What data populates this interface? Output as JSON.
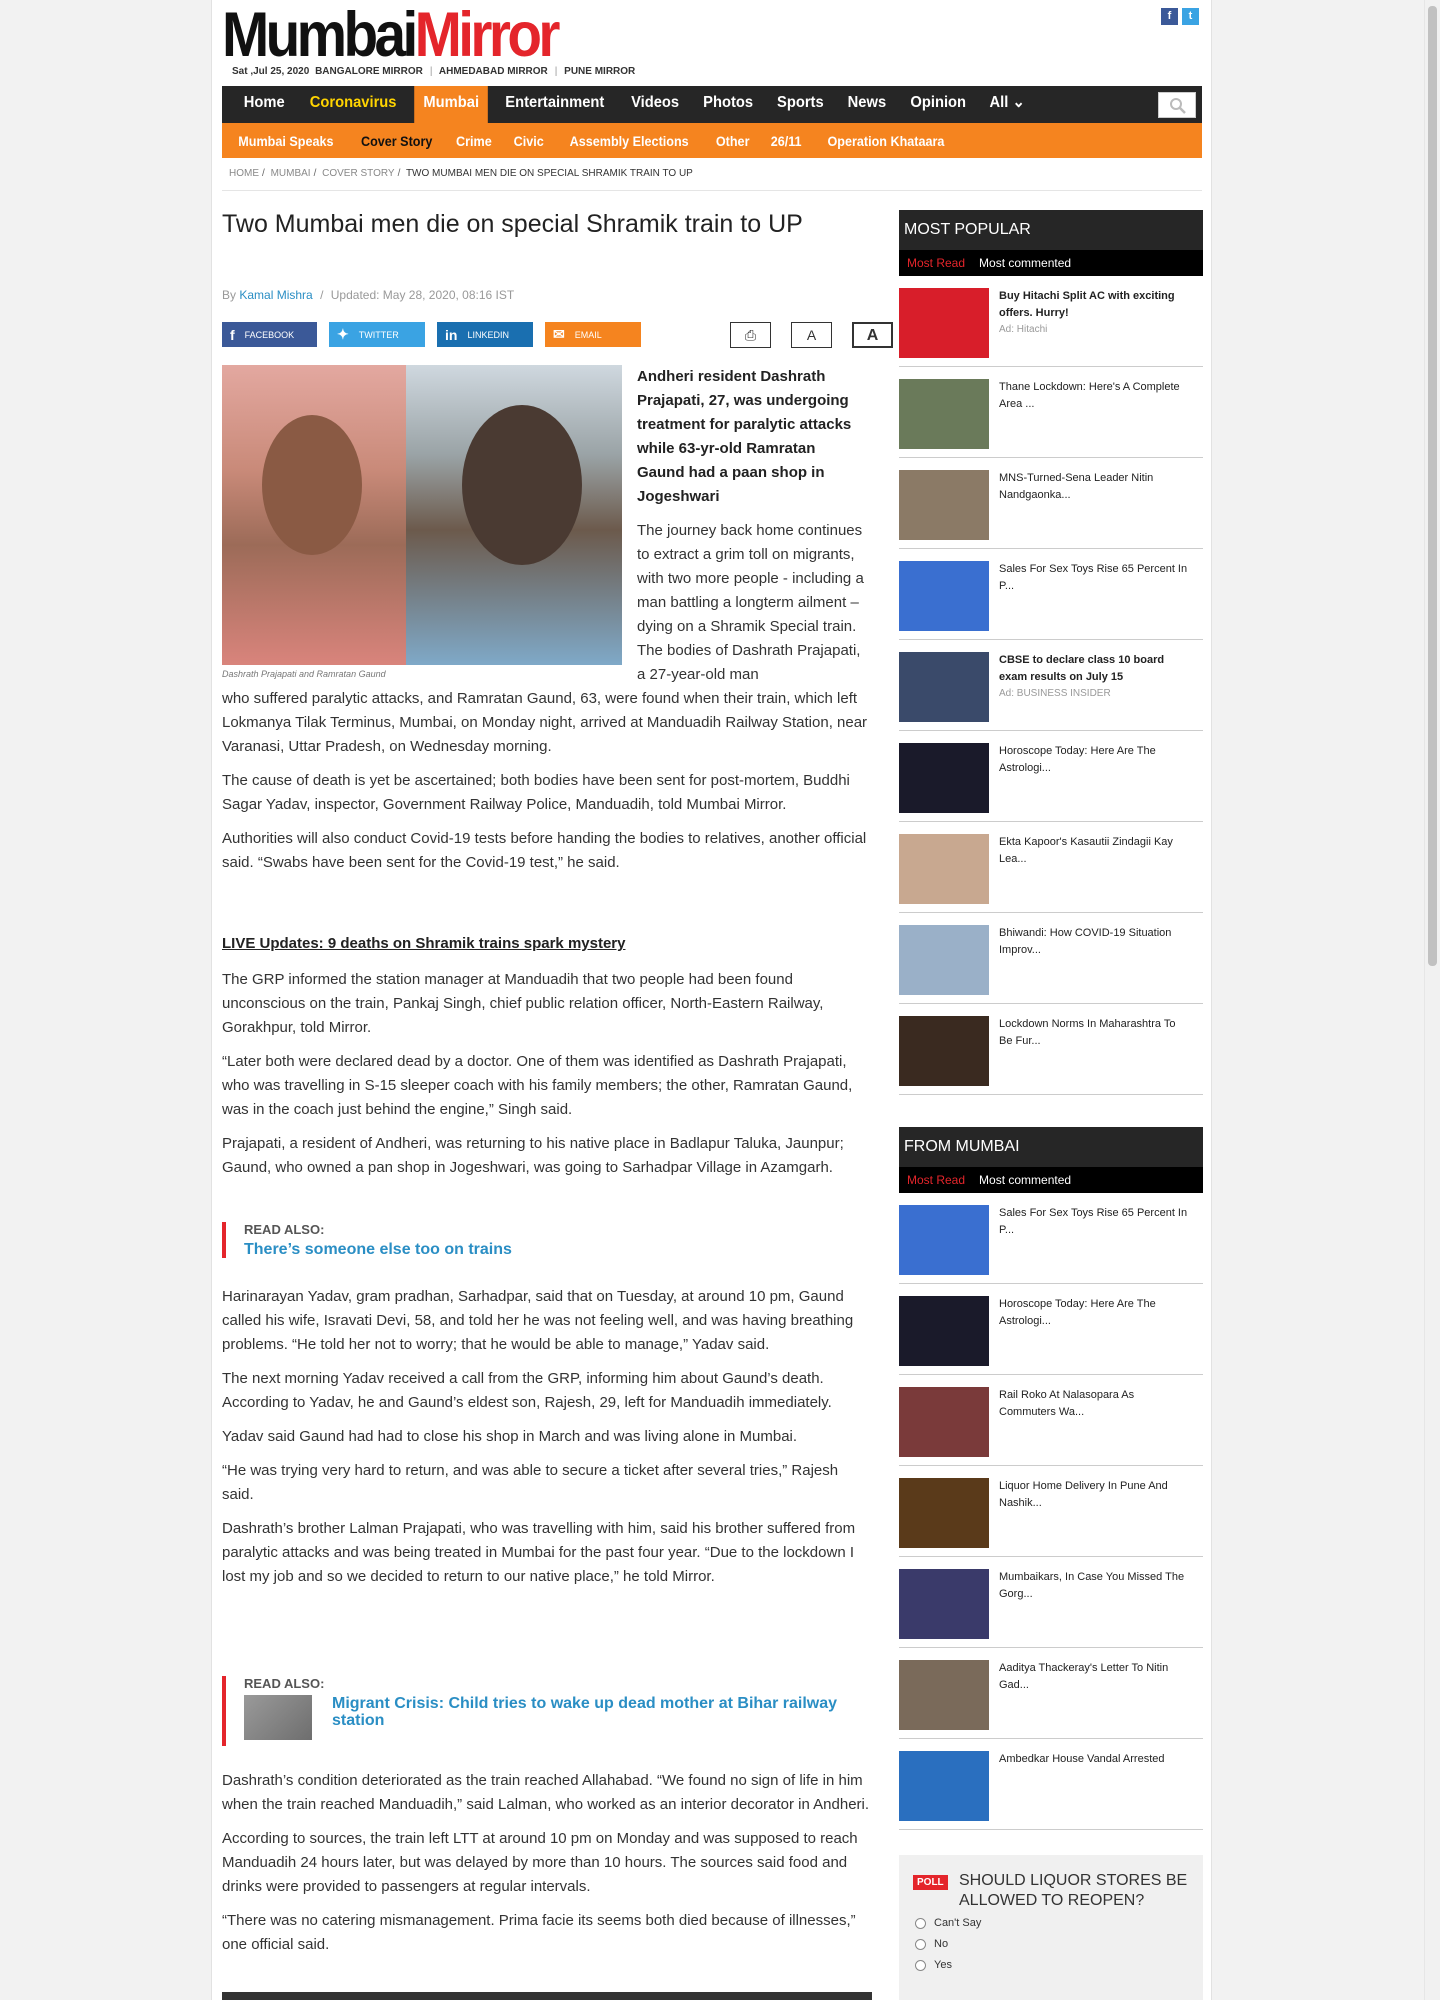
{
  "header": {
    "logo_part1": "Mumbai",
    "logo_part2": "Mirror",
    "date": "Sat ,Jul 25, 2020",
    "editions": [
      "BANGALORE MIRROR",
      "AHMEDABAD MIRROR",
      "PUNE MIRROR"
    ],
    "social": [
      "f",
      "t"
    ]
  },
  "nav": {
    "primary": [
      "Home",
      "Coronavirus",
      "Mumbai",
      "Entertainment",
      "Videos",
      "Photos",
      "Sports",
      "News",
      "Opinion",
      "All"
    ],
    "secondary": [
      "Mumbai Speaks",
      "Cover Story",
      "Crime",
      "Civic",
      "Assembly Elections",
      "Other",
      "26/11",
      "Operation Khataara"
    ]
  },
  "breadcrumb": [
    "HOME",
    "MUMBAI",
    "COVER STORY",
    "TWO MUMBAI MEN DIE ON SPECIAL SHRAMIK TRAIN TO UP"
  ],
  "article": {
    "title": "Two Mumbai men die on special Shramik train to UP",
    "by": "By",
    "author": "Kamal Mishra",
    "updated": "Updated: May 28, 2020, 08:16 IST",
    "share": [
      "FACEBOOK",
      "TWITTER",
      "LINKEDIN",
      "EMAIL"
    ],
    "font_small": "A",
    "font_big": "A",
    "caption": "Dashrath Prajapati and Ramratan Gaund",
    "summary": "Andheri resident Dashrath Prajapati, 27, was undergoing treatment for paralytic attacks while 63-yr-old Ramratan Gaund had a paan shop in Jogeshwari",
    "p1_wrap": "The journey back home continues to extract a grim toll on migrants, with two more people - including a man battling a longterm ailment – dying on a Shramik Special train. The bodies of Dashrath Prajapati, a 27-year-old man",
    "p1_rest": "who suffered paralytic attacks, and Ramratan Gaund, 63, were found when their train, which left Lokmanya Tilak Terminus, Mumbai, on Monday night, arrived at Manduadih Railway Station, near Varanasi, Uttar Pradesh, on Wednesday morning.",
    "p2": "The cause of death is yet be ascertained; both bodies have been sent for post-mortem, Buddhi Sagar Yadav, inspector, Government Railway Police, Manduadih, told Mumbai Mirror.",
    "p3": "Authorities will also conduct Covid-19 tests before handing the bodies to relatives, another official said. “Swabs have been sent for the Covid-19 test,” he said.",
    "live": "LIVE Updates: 9 deaths on Shramik trains spark mystery",
    "p4": "The GRP informed the station manager at Manduadih that two people had been found unconscious on the train, Pankaj Singh, chief public relation officer, North-Eastern Railway, Gorakhpur, told Mirror.",
    "p5": "“Later both were declared dead by a doctor. One of them was identified as Dashrath Prajapati, who was travelling in S-15 sleeper coach with his family members; the other, Ramratan Gaund, was in the coach just behind the engine,” Singh said.",
    "p6": "Prajapati, a resident of Andheri, was returning to his native place in Badlapur Taluka, Jaunpur; Gaund, who owned a pan shop in Jogeshwari, was going to Sarhadpar Village in Azamgarh.",
    "read1_label": "READ ALSO:",
    "read1_link": "There’s someone else too on trains",
    "p7": "Harinarayan Yadav, gram pradhan, Sarhadpar, said that on Tuesday, at around 10 pm, Gaund called his wife, Isravati Devi, 58, and told her he was not feeling well, and was having breathing problems. “He told her not to worry; that he would be able to manage,” Yadav said.",
    "p8": "The next morning Yadav received a call from the GRP, informing him about Gaund’s death. According to Yadav, he and Gaund’s eldest son, Rajesh, 29, left for Manduadih immediately.",
    "p9": "Yadav said Gaund had had to close his shop in March and was living alone in Mumbai.",
    "p10": "“He was trying very hard to return, and was able to secure a ticket after several tries,” Rajesh said.",
    "p11": "Dashrath’s brother Lalman Prajapati, who was travelling with him, said his brother suffered from paralytic attacks and was being treated in Mumbai for the past four year. “Due to the lockdown I lost my job and so we decided to return to our native place,” he told Mirror.",
    "read2_label": "READ ALSO:",
    "read2_link": "Migrant Crisis: Child tries to wake up dead mother at Bihar railway station",
    "p12": "Dashrath’s condition deteriorated as the train reached Allahabad. “We found no sign of life in him when the train reached Manduadih,” said Lalman, who worked as an interior decorator in Andheri.",
    "p13": "According to sources, the train left LTT at around 10 pm on Monday and was supposed to reach Manduadih 24 hours later, but was delayed by more than 10 hours. The sources said food and drinks were provided to passengers at regular intervals.",
    "p14": "“There was no catering mismanagement. Prima facie its seems both died because of illnesses,” one official said."
  },
  "most_popular": {
    "heading": "MOST POPULAR",
    "tab_a": "Most Read",
    "tab_b": "Most commented",
    "items": [
      {
        "text": "Buy Hitachi Split AC with exciting offers. Hurry!",
        "ad": "Ad: Hitachi",
        "color": "#d81e2a"
      },
      {
        "text": "Thane Lockdown: Here's A Complete Area ...",
        "color": "#6a7a5a"
      },
      {
        "text": "MNS-Turned-Sena Leader Nitin Nandgaonka...",
        "color": "#8b7a66"
      },
      {
        "text": "Sales For Sex Toys Rise 65 Percent In P...",
        "color": "#3a6fd0"
      },
      {
        "text": "CBSE to declare class 10 board exam results on July 15",
        "ad": "Ad: BUSINESS INSIDER",
        "color": "#3a4a6a"
      },
      {
        "text": "Horoscope Today: Here Are The Astrologi...",
        "color": "#1a1a2a"
      },
      {
        "text": "Ekta Kapoor's Kasautii Zindagii Kay Lea...",
        "color": "#c8a890"
      },
      {
        "text": "Bhiwandi: How COVID-19 Situation Improv...",
        "color": "#9ab0c8"
      },
      {
        "text": "Lockdown Norms In Maharashtra To Be Fur...",
        "color": "#3a2a20"
      }
    ]
  },
  "from_mumbai": {
    "heading": "FROM MUMBAI",
    "tab_a": "Most Read",
    "tab_b": "Most commented",
    "items": [
      {
        "text": "Sales For Sex Toys Rise 65 Percent In P...",
        "color": "#3a6fd0"
      },
      {
        "text": "Horoscope Today: Here Are The Astrologi...",
        "color": "#1a1a2a"
      },
      {
        "text": "Rail Roko At Nalasopara As Commuters Wa...",
        "color": "#7a3a3a"
      },
      {
        "text": "Liquor Home Delivery In Pune And Nashik...",
        "color": "#5a3a1a"
      },
      {
        "text": "Mumbaikars, In Case You Missed The Gorg...",
        "color": "#3a3a6a"
      },
      {
        "text": "Aaditya Thackeray's Letter To Nitin Gad...",
        "color": "#7a6a5a"
      },
      {
        "text": "Ambedkar House Vandal Arrested",
        "color": "#2a6fbf"
      }
    ]
  },
  "poll": {
    "tag": "POLL",
    "question": "SHOULD LIQUOR STORES BE ALLOWED TO REOPEN?",
    "options": [
      "Can't Say",
      "No",
      "Yes"
    ]
  }
}
